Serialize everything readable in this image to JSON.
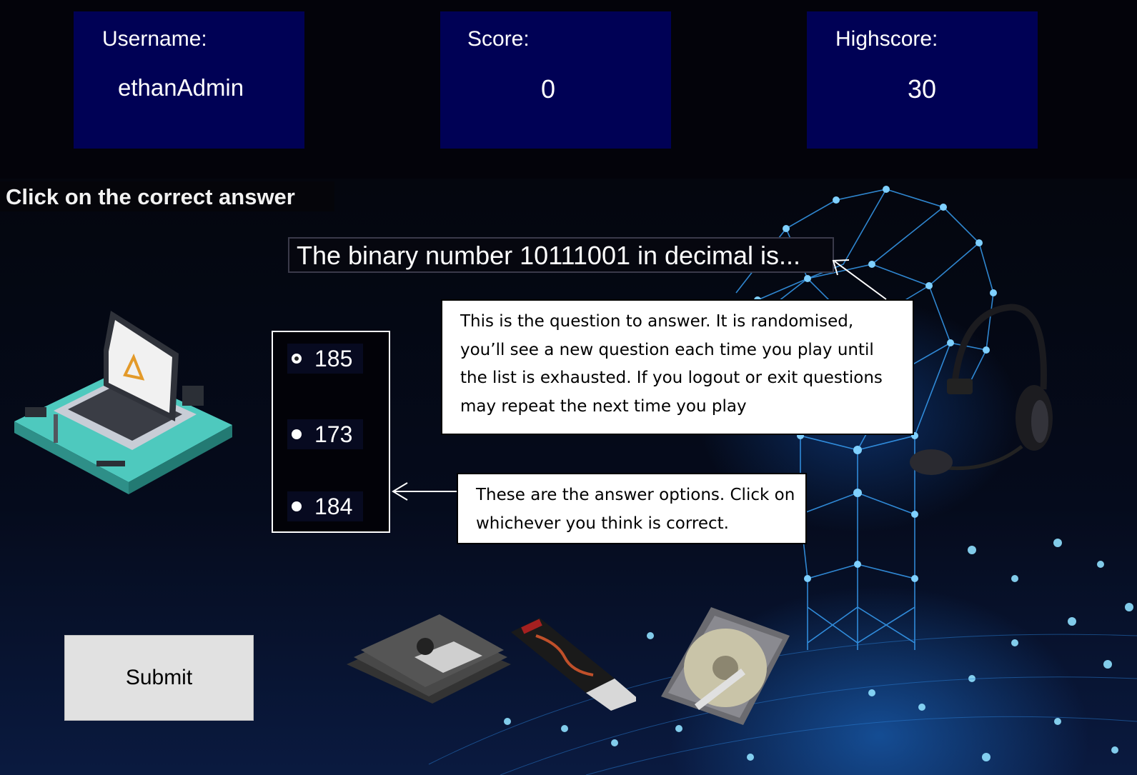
{
  "header": {
    "username_label": "Username:",
    "username_value": "ethanAdmin",
    "score_label": "Score:",
    "score_value": "0",
    "highscore_label": "Highscore:",
    "highscore_value": "30",
    "box_color": "#000155"
  },
  "quiz": {
    "instruction": "Click on the correct answer",
    "question": "The binary number 10111001 in decimal is...",
    "options": [
      {
        "label": "185",
        "selected": true
      },
      {
        "label": "173",
        "selected": false
      },
      {
        "label": "184",
        "selected": false
      }
    ],
    "submit_label": "Submit"
  },
  "annotations": {
    "question_note": "This is the question to answer. It is randomised, you’ll see a new question each time you play until the list is exhausted. If you logout or exit questions may repeat the next time you play",
    "options_note": "These are the answer options. Click on whichever you think is correct."
  },
  "decorations": [
    "laptop-illustration",
    "floppy-disks",
    "usb-drive",
    "hard-drive",
    "headset",
    "network-head-graphic"
  ]
}
